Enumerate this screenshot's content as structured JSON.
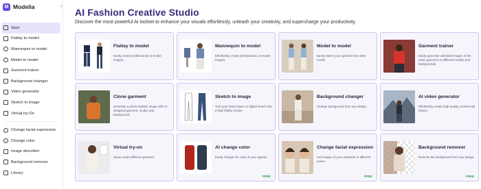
{
  "app": {
    "name": "Modelia",
    "logo_letter": "M"
  },
  "sidebar": {
    "items": [
      {
        "label": "Start",
        "icon": "home-icon",
        "active": true
      },
      {
        "label": "Flatlay to model",
        "icon": "shirt-icon"
      },
      {
        "label": "Mannequin to model",
        "icon": "mannequin-icon"
      },
      {
        "label": "Model to model",
        "icon": "person-icon"
      },
      {
        "label": "Garment trainer",
        "icon": "garment-icon"
      },
      {
        "label": "Background changer",
        "icon": "image-icon"
      },
      {
        "label": "Video generator",
        "icon": "video-icon"
      },
      {
        "label": "Sketch to image",
        "icon": "pencil-icon"
      },
      {
        "label": "Virtual try-On",
        "icon": "hanger-icon"
      }
    ],
    "items2": [
      {
        "label": "Change facial expression",
        "icon": "face-icon"
      },
      {
        "label": "Change color",
        "icon": "palette-icon"
      },
      {
        "label": "Image describer",
        "icon": "doc-icon"
      },
      {
        "label": "Background remover",
        "icon": "eraser-icon"
      },
      {
        "label": "Library",
        "icon": "library-icon"
      }
    ]
  },
  "header": {
    "title": "AI Fashion Creative Studio",
    "subtitle": "Discover the most powerful AI toolset to enhance your visuals effortlessly, unleash your creativity, and supercharge your productivity."
  },
  "cards": [
    {
      "title": "Flatlay to model",
      "desc": "Easily create professional on-model images.",
      "badge": ""
    },
    {
      "title": "Mannequin to model",
      "desc": "Effortlessly create professional, on-model images.",
      "badge": ""
    },
    {
      "title": "Model to model",
      "desc": "Easily switch your garment into other model.",
      "badge": ""
    },
    {
      "title": "Garment trainer",
      "desc": "Easily generate unlimited images of the same garment on different models and backgrounds.",
      "badge": ""
    },
    {
      "title": "Clone garment",
      "desc": "Generate a photo-realistic image with AI-designed garment, model, and background.",
      "badge": ""
    },
    {
      "title": "Sketch to image",
      "desc": "Turn your hand-drawn or digital sketch into a high fidelity render.",
      "badge": ""
    },
    {
      "title": "Background changer",
      "desc": "Change background from any design.",
      "badge": ""
    },
    {
      "title": "AI video generator",
      "desc": "Effortlessly create high-quality commercial videos.",
      "badge": ""
    },
    {
      "title": "Virtual try-on",
      "desc": "Same model different garment.",
      "badge": ""
    },
    {
      "title": "AI change color",
      "desc": "Easily change the color of your appeal.",
      "badge": "FREE"
    },
    {
      "title": "Change facial expression",
      "desc": "Get images of your character in different poses.",
      "badge": "FREE"
    },
    {
      "title": "Background remover",
      "desc": "Remove the background from any design.",
      "badge": "FREE"
    }
  ],
  "colors": {
    "accent": "#6a4bd8",
    "title": "#3a2a7c",
    "card_border": "#ccc6ec",
    "free": "#2e9c4d",
    "active_bg": "#e8e3fb"
  }
}
